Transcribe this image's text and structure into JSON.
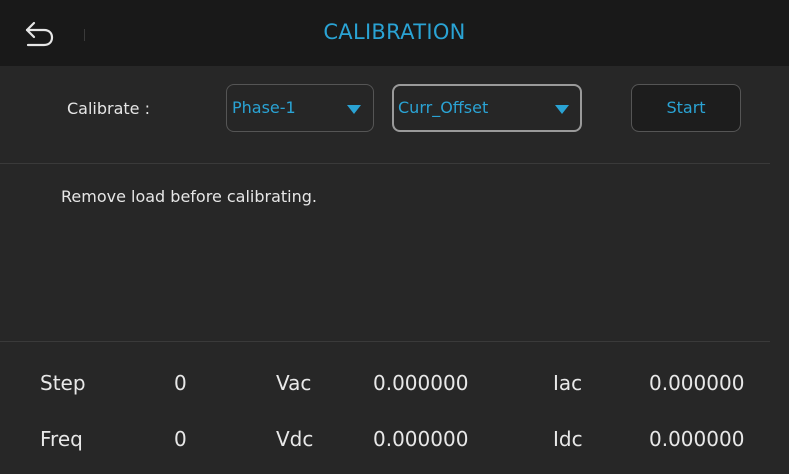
{
  "header": {
    "title": "CALIBRATION"
  },
  "controls": {
    "calibrate_label": "Calibrate :",
    "phase_select": {
      "value": "Phase-1"
    },
    "type_select": {
      "value": "Curr_Offset"
    },
    "start_label": "Start"
  },
  "message": "Remove load before calibrating.",
  "readings": {
    "row1": {
      "step_label": "Step",
      "step_value": "0",
      "vac_label": "Vac",
      "vac_value": "0.000000",
      "iac_label": "Iac",
      "iac_value": "0.000000"
    },
    "row2": {
      "freq_label": "Freq",
      "freq_value": "0",
      "vdc_label": "Vdc",
      "vdc_value": "0.000000",
      "idc_label": "Idc",
      "idc_value": "0.000000"
    }
  },
  "colors": {
    "accent": "#2aa3d4",
    "background": "#272727",
    "header": "#191919",
    "text": "#e6e6e6"
  },
  "icons": {
    "back": "back-arrow-icon",
    "dropdown": "triangle-down-icon"
  }
}
